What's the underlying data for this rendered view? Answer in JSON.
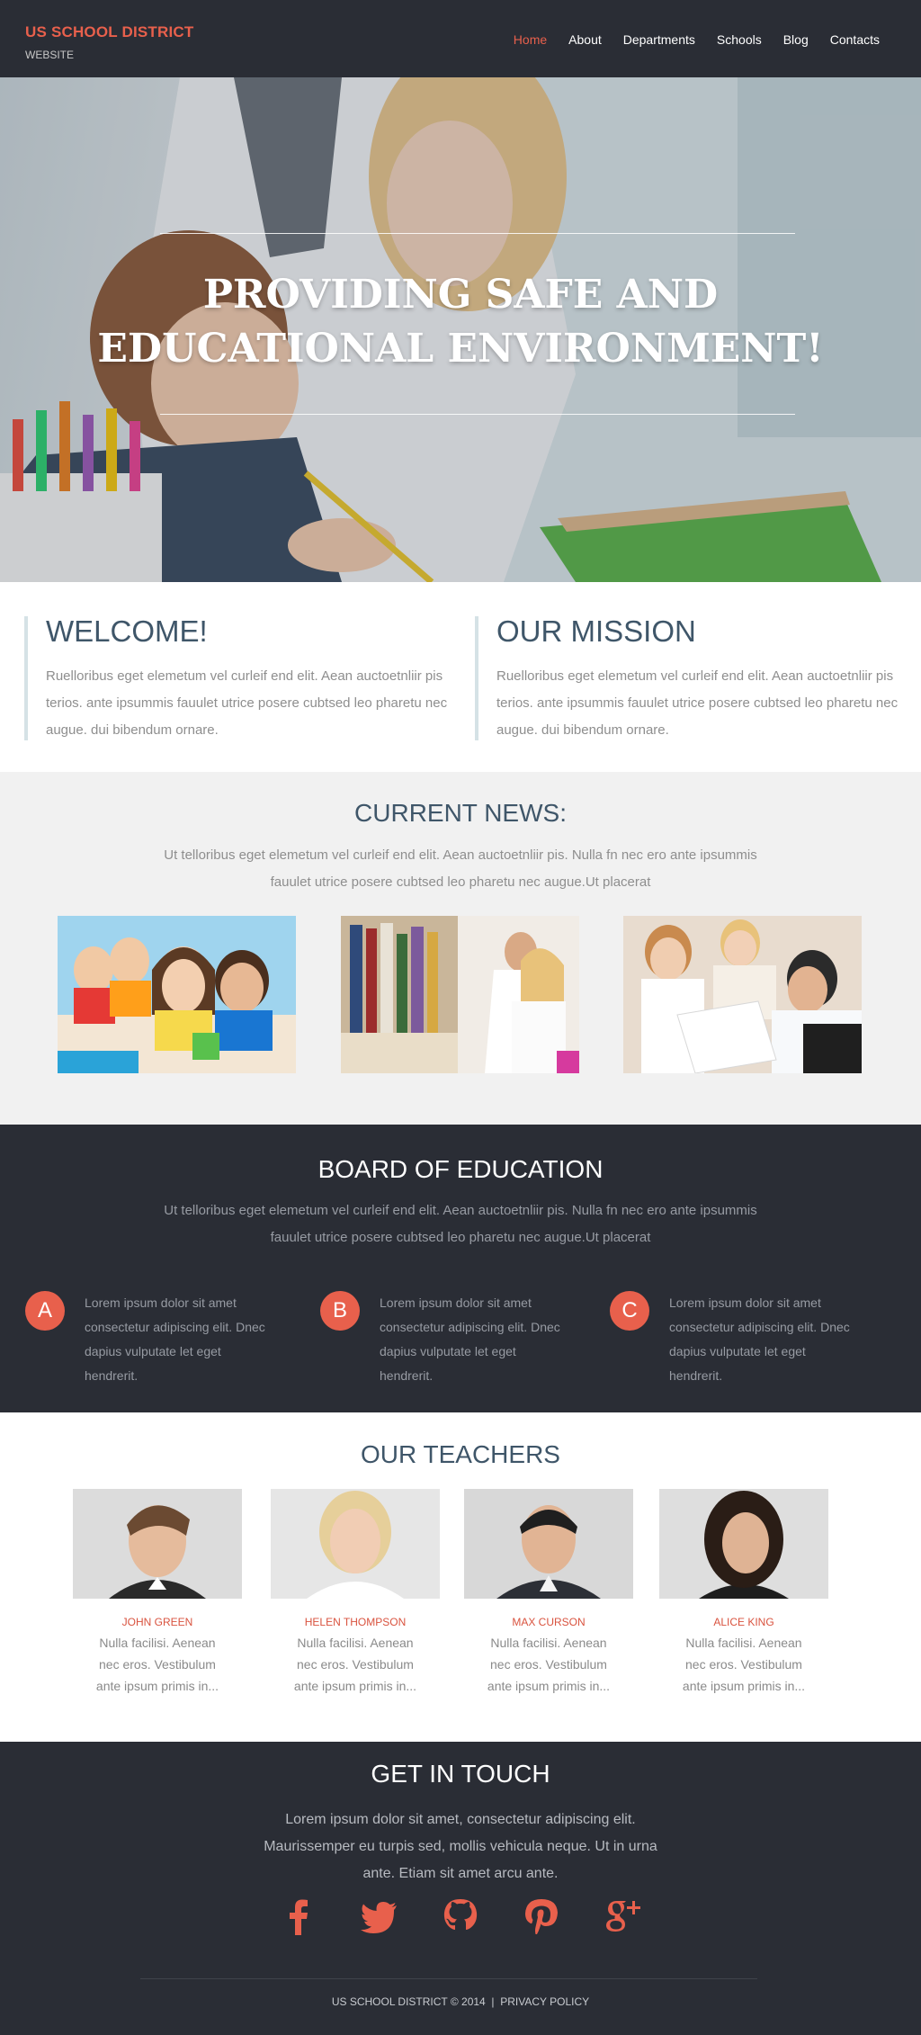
{
  "header": {
    "brand_title": "US SCHOOL DISTRICT",
    "brand_subtitle": "WEBSITE",
    "nav": [
      "Home",
      "About",
      "Departments",
      "Schools",
      "Blog",
      "Contacts"
    ],
    "active_nav": "Home"
  },
  "hero": {
    "title_line1": "PROVIDING SAFE AND",
    "title_line2": "EDUCATIONAL ENVIRONMENT!"
  },
  "welcome": {
    "title": "WELCOME!",
    "text": "Ruelloribus eget elemetum vel curleif end elit. Aean auctoetnliir pis terios. ante ipsummis fauulet utrice posere cubtsed leo pharetu nec augue. dui bibendum ornare."
  },
  "mission": {
    "title": "OUR MISSION",
    "text": "Ruelloribus eget elemetum vel curleif end elit. Aean auctoetnliir pis terios. ante ipsummis fauulet utrice posere cubtsed leo pharetu nec augue. dui bibendum ornare."
  },
  "news": {
    "title": "CURRENT NEWS:",
    "text": "Ut telloribus eget elemetum vel curleif end elit. Aean auctoetnliir pis. Nulla fn nec ero ante ipsummis fauulet utrice posere cubtsed leo pharetu nec augue.Ut placerat"
  },
  "board": {
    "title": "BOARD OF EDUCATION",
    "text": "Ut telloribus eget elemetum vel curleif end elit. Aean auctoetnliir pis. Nulla fn nec ero ante ipsummis fauulet utrice posere cubtsed leo pharetu nec augue.Ut placerat",
    "items": [
      {
        "letter": "A",
        "text": "Lorem ipsum dolor sit amet consectetur adipiscing elit. Dnec dapius vulputate let eget hendrerit."
      },
      {
        "letter": "B",
        "text": "Lorem ipsum dolor sit amet consectetur adipiscing elit. Dnec dapius vulputate let eget hendrerit."
      },
      {
        "letter": "C",
        "text": "Lorem ipsum dolor sit amet consectetur adipiscing elit. Dnec dapius vulputate let eget hendrerit."
      }
    ]
  },
  "teachers": {
    "title": "OUR TEACHERS",
    "list": [
      {
        "name": "JOHN GREEN",
        "bio": "Nulla facilisi. Aenean nec eros. Vestibulum ante ipsum primis in..."
      },
      {
        "name": "HELEN THOMPSON",
        "bio": "Nulla facilisi. Aenean nec eros. Vestibulum ante ipsum primis in..."
      },
      {
        "name": "MAX CURSON",
        "bio": "Nulla facilisi. Aenean nec eros. Vestibulum ante ipsum primis in..."
      },
      {
        "name": "ALICE KING",
        "bio": "Nulla facilisi. Aenean nec eros. Vestibulum ante ipsum primis in..."
      }
    ]
  },
  "contact": {
    "title": "GET IN TOUCH",
    "text": "Lorem ipsum dolor sit amet, consectetur adipiscing elit. Maurissemper eu turpis sed, mollis vehicula neque. Ut in urna ante. Etiam sit amet arcu ante.",
    "social": [
      "facebook-icon",
      "twitter-icon",
      "github-icon",
      "pinterest-icon",
      "google-plus-icon"
    ]
  },
  "footer": {
    "copyright": "US SCHOOL DISTRICT © 2014",
    "separator": "|",
    "privacy": "PRIVACY POLICY"
  },
  "colors": {
    "accent": "#e8604c",
    "dark": "#2a2d35",
    "heading": "#3f5669",
    "light_bg": "#f1f1f1"
  }
}
